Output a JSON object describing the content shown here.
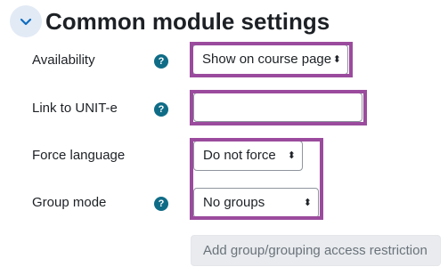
{
  "section": {
    "title": "Common module settings",
    "collapse_icon": "chevron-down-icon"
  },
  "fields": {
    "availability": {
      "label": "Availability",
      "value": "Show on course page"
    },
    "link": {
      "label": "Link to UNIT-e",
      "value": ""
    },
    "force_language": {
      "label": "Force language",
      "value": "Do not force"
    },
    "group_mode": {
      "label": "Group mode",
      "value": "No groups"
    }
  },
  "help_icon": {
    "glyph": "?"
  },
  "select_arrow": "⬍",
  "access_button": {
    "label": "Add group/grouping access restriction"
  },
  "colors": {
    "highlight": "#9b4b9d",
    "help_icon": "#0f6c86",
    "collapse_bg": "#e2eaf5"
  }
}
